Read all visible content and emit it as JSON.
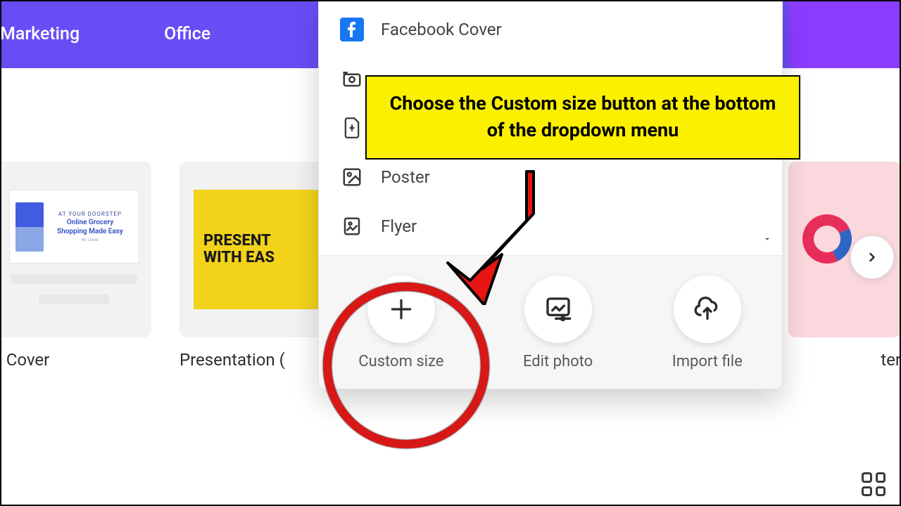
{
  "nav": {
    "items": [
      "Marketing",
      "Office"
    ]
  },
  "carousel": {
    "card1": {
      "tagline_top": "AT YOUR DOORSTEP",
      "tagline_mid1": "Online Grocery",
      "tagline_mid2": "Shopping Made Easy",
      "tagline_sub": "M. Lewis",
      "label": "t Cover"
    },
    "card2": {
      "line1": "PRESENT",
      "line2": "WITH EAS",
      "label": "Presentation ("
    },
    "card5": {
      "label": "ter"
    }
  },
  "dropdown": {
    "items": [
      {
        "key": "facebook_cover",
        "label": "Facebook Cover"
      },
      {
        "key": "camera_item",
        "label": ""
      },
      {
        "key": "doc_item",
        "label": ""
      },
      {
        "key": "poster",
        "label": "Poster"
      },
      {
        "key": "flyer",
        "label": "Flyer"
      }
    ],
    "footer": {
      "custom_size": "Custom size",
      "edit_photo": "Edit photo",
      "import_file": "Import file"
    }
  },
  "callout": {
    "text": "Choose the Custom size button at the bottom of the dropdown menu"
  }
}
